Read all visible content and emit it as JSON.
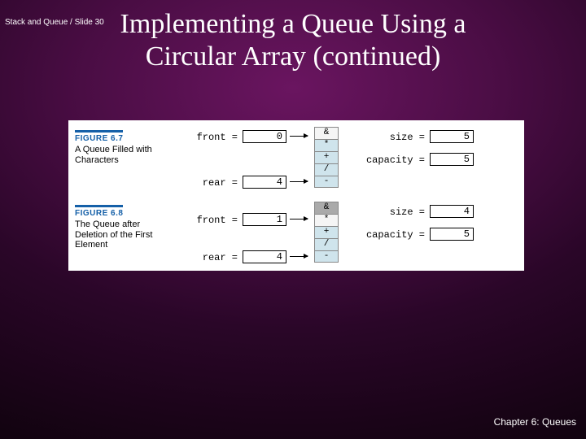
{
  "breadcrumb": "Stack and Queue / Slide 30",
  "title_line1": "Implementing a Queue Using a",
  "title_line2": "Circular Array (continued)",
  "fig1": {
    "num": "FIGURE 6.7",
    "caption": "A Queue Filled with Characters",
    "front_label": "front =",
    "front_val": "0",
    "rear_label": "rear =",
    "rear_val": "4",
    "size_label": "size =",
    "size_val": "5",
    "capacity_label": "capacity =",
    "capacity_val": "5",
    "cells": [
      "&",
      "*",
      "+",
      "/",
      "-"
    ]
  },
  "fig2": {
    "num": "FIGURE 6.8",
    "caption": "The Queue after Deletion of the First Element",
    "front_label": "front =",
    "front_val": "1",
    "rear_label": "rear =",
    "rear_val": "4",
    "size_label": "size =",
    "size_val": "4",
    "capacity_label": "capacity =",
    "capacity_val": "5",
    "cells": [
      "&",
      "*",
      "+",
      "/",
      "-"
    ]
  },
  "footer": "Chapter 6: Queues"
}
